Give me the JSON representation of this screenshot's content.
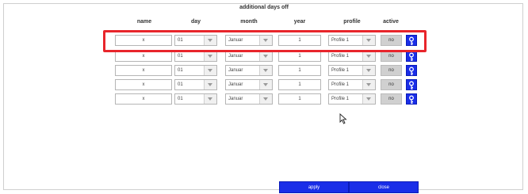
{
  "dialog": {
    "title": "additional days off"
  },
  "columns": {
    "name": "name",
    "day": "day",
    "month": "month",
    "year": "year",
    "profile": "profile",
    "active": "active"
  },
  "rows": [
    {
      "name": "x",
      "day": "01",
      "month": "Januar",
      "year": "1",
      "profile": "Profile 1",
      "active": "no"
    },
    {
      "name": "x",
      "day": "01",
      "month": "Januar",
      "year": "1",
      "profile": "Profile 1",
      "active": "no"
    },
    {
      "name": "x",
      "day": "01",
      "month": "Januar",
      "year": "1",
      "profile": "Profile 1",
      "active": "no"
    },
    {
      "name": "x",
      "day": "01",
      "month": "Januar",
      "year": "1",
      "profile": "Profile 1",
      "active": "no"
    },
    {
      "name": "x",
      "day": "01",
      "month": "Januar",
      "year": "1",
      "profile": "Profile 1",
      "active": "no"
    }
  ],
  "footer": {
    "apply_label": "apply",
    "close_label": "close"
  },
  "icons": {
    "key": "key-icon",
    "dropdown": "chevron-down-icon",
    "cursor": "mouse-cursor-icon"
  },
  "colors": {
    "accent": "#1a2ee8",
    "highlight": "#e8252b"
  }
}
